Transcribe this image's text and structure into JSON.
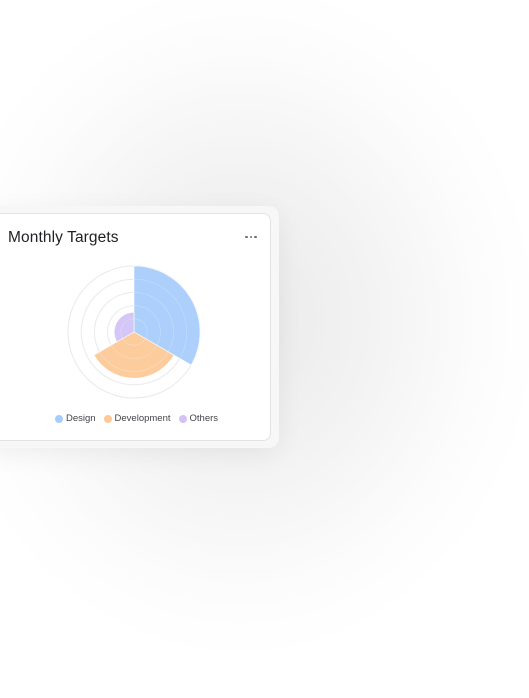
{
  "card": {
    "title": "Monthly Targets",
    "menu_icon": "more-horizontal-icon"
  },
  "colors": {
    "design": "#a8ccfb",
    "development": "#fcc998",
    "others": "#d2c3f7",
    "ring": "#e4e4e8"
  },
  "chart_data": {
    "type": "polarArea",
    "series": [
      {
        "name": "Design",
        "value": 10
      },
      {
        "name": "Development",
        "value": 7
      },
      {
        "name": "Others",
        "value": 3
      }
    ],
    "scale_max": 10,
    "legend_position": "bottom"
  },
  "legend": [
    {
      "label": "Design"
    },
    {
      "label": "Development"
    },
    {
      "label": "Others"
    }
  ]
}
